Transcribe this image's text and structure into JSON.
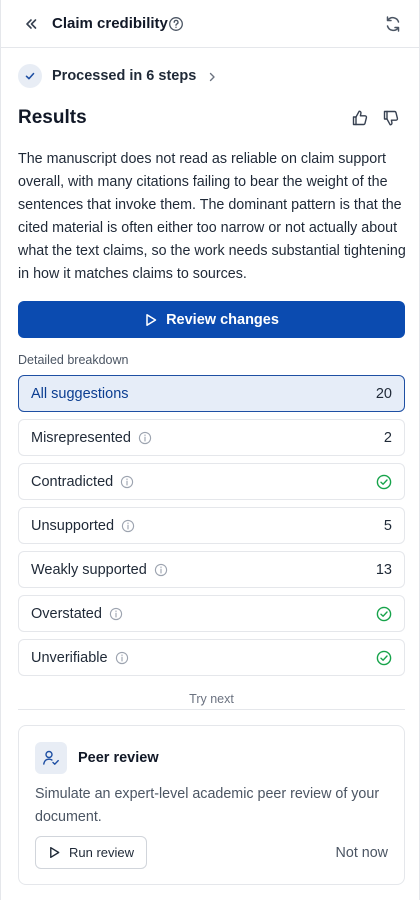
{
  "header": {
    "title": "Claim credibility"
  },
  "processed": {
    "label": "Processed in 6 steps"
  },
  "results": {
    "title": "Results",
    "summary": "The manuscript does not read as reliable on claim support overall, with many citations failing to bear the weight of the sentences that invoke them. The dominant pattern is that the cited material is often either too narrow or not actually about what the text claims, so the work needs substantial tightening in how it matches claims to sources."
  },
  "actions": {
    "review_label": "Review changes"
  },
  "breakdown": {
    "label": "Detailed breakdown",
    "rows": [
      {
        "label": "All suggestions",
        "count": "20",
        "active": true,
        "info": false,
        "check": false
      },
      {
        "label": "Misrepresented",
        "count": "2",
        "active": false,
        "info": true,
        "check": false
      },
      {
        "label": "Contradicted",
        "count": "",
        "active": false,
        "info": true,
        "check": true
      },
      {
        "label": "Unsupported",
        "count": "5",
        "active": false,
        "info": true,
        "check": false
      },
      {
        "label": "Weakly supported",
        "count": "13",
        "active": false,
        "info": true,
        "check": false
      },
      {
        "label": "Overstated",
        "count": "",
        "active": false,
        "info": true,
        "check": true
      },
      {
        "label": "Unverifiable",
        "count": "",
        "active": false,
        "info": true,
        "check": true
      }
    ]
  },
  "try_next": {
    "label": "Try next",
    "card": {
      "icon": "user-check-icon",
      "title": "Peer review",
      "description": "Simulate an expert-level academic peer review of your document.",
      "run_label": "Run review",
      "dismiss_label": "Not now"
    }
  },
  "colors": {
    "primary": "#0b4bb0",
    "active_row_bg": "#e6edf8",
    "active_row_border": "#1e4fa3",
    "success": "#16a34a",
    "border": "#e5e7eb"
  }
}
